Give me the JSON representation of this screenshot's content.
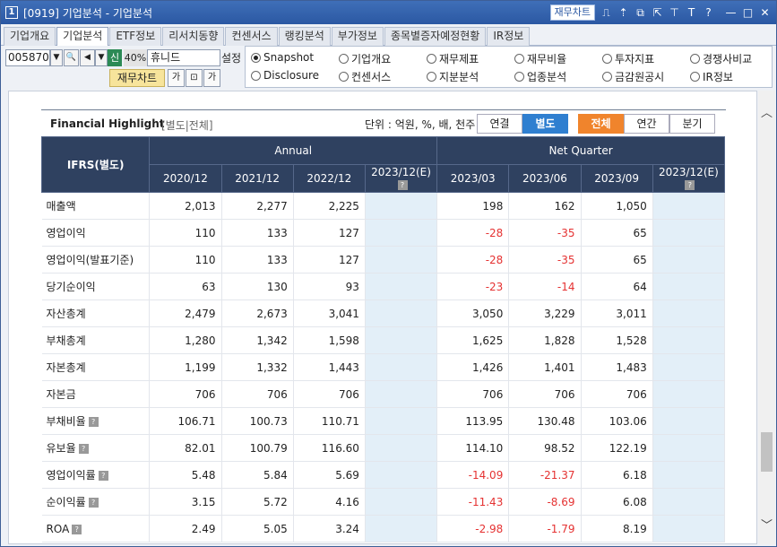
{
  "window": {
    "number": "1",
    "title": "[0919] 기업분석 - 기업분석",
    "chart_btn": "재무차트",
    "icons": [
      "chart-icon",
      "pin-up-icon",
      "copy-icon",
      "link-icon",
      "pin-icon",
      "text-icon",
      "help-icon",
      "minimize-icon",
      "maximize-icon",
      "close-icon"
    ],
    "icon_glyphs": [
      "⎍",
      "⇡",
      "⧉",
      "⇱",
      "⊤",
      "T",
      "?",
      "—",
      "□",
      "✕"
    ]
  },
  "tabs": [
    "기업개요",
    "기업분석",
    "ETF정보",
    "리서치동향",
    "컨센서스",
    "랭킹분석",
    "부가정보",
    "종목별증자예정현황",
    "IR정보"
  ],
  "controls": {
    "code": "005870",
    "badge": "신",
    "percent": "40%",
    "name": "휴니드",
    "setting": "설정",
    "fin_chart": "재무차트"
  },
  "radios": [
    {
      "label": "Snapshot",
      "checked": true
    },
    {
      "label": "기업개요",
      "checked": false
    },
    {
      "label": "재무제표",
      "checked": false
    },
    {
      "label": "재무비율",
      "checked": false
    },
    {
      "label": "투자지표",
      "checked": false
    },
    {
      "label": "경쟁사비교",
      "checked": false
    },
    {
      "label": "Disclosure",
      "checked": false
    },
    {
      "label": "컨센서스",
      "checked": false
    },
    {
      "label": "지분분석",
      "checked": false
    },
    {
      "label": "업종분석",
      "checked": false
    },
    {
      "label": "금감원공시",
      "checked": false
    },
    {
      "label": "IR정보",
      "checked": false
    }
  ],
  "highlight": {
    "title": "Financial Highlight",
    "subtitle": "[별도|전체]",
    "unit": "단위 : 억원, %, 배, 천주",
    "toggle1": [
      "연결",
      "별도"
    ],
    "toggle2": [
      "전체",
      "연간",
      "분기"
    ],
    "header_label": "IFRS(별도)",
    "group1": "Annual",
    "group2": "Net Quarter",
    "columns": [
      "2020/12",
      "2021/12",
      "2022/12",
      "2023/12(E)",
      "2023/03",
      "2023/06",
      "2023/09",
      "2023/12(E)"
    ],
    "rows": [
      {
        "label": "매출액",
        "help": false,
        "values": [
          "2,013",
          "2,277",
          "2,225",
          "",
          "198",
          "162",
          "1,050",
          ""
        ]
      },
      {
        "label": "영업이익",
        "help": false,
        "values": [
          "110",
          "133",
          "127",
          "",
          "-28",
          "-35",
          "65",
          ""
        ]
      },
      {
        "label": "영업이익(발표기준)",
        "help": false,
        "values": [
          "110",
          "133",
          "127",
          "",
          "-28",
          "-35",
          "65",
          ""
        ]
      },
      {
        "label": "당기순이익",
        "help": false,
        "values": [
          "63",
          "130",
          "93",
          "",
          "-23",
          "-14",
          "64",
          ""
        ]
      },
      {
        "label": "자산총계",
        "help": false,
        "values": [
          "2,479",
          "2,673",
          "3,041",
          "",
          "3,050",
          "3,229",
          "3,011",
          ""
        ]
      },
      {
        "label": "부채총계",
        "help": false,
        "values": [
          "1,280",
          "1,342",
          "1,598",
          "",
          "1,625",
          "1,828",
          "1,528",
          ""
        ]
      },
      {
        "label": "자본총계",
        "help": false,
        "values": [
          "1,199",
          "1,332",
          "1,443",
          "",
          "1,426",
          "1,401",
          "1,483",
          ""
        ]
      },
      {
        "label": "자본금",
        "help": false,
        "values": [
          "706",
          "706",
          "706",
          "",
          "706",
          "706",
          "706",
          ""
        ]
      },
      {
        "label": "부채비율",
        "help": true,
        "values": [
          "106.71",
          "100.73",
          "110.71",
          "",
          "113.95",
          "130.48",
          "103.06",
          ""
        ]
      },
      {
        "label": "유보율",
        "help": true,
        "values": [
          "82.01",
          "100.79",
          "116.60",
          "",
          "114.10",
          "98.52",
          "122.19",
          ""
        ]
      },
      {
        "label": "영업이익률",
        "help": true,
        "values": [
          "5.48",
          "5.84",
          "5.69",
          "",
          "-14.09",
          "-21.37",
          "6.18",
          ""
        ]
      },
      {
        "label": "순이익률",
        "help": true,
        "values": [
          "3.15",
          "5.72",
          "4.16",
          "",
          "-11.43",
          "-8.69",
          "6.08",
          ""
        ]
      },
      {
        "label": "ROA",
        "help": true,
        "values": [
          "2.49",
          "5.05",
          "3.24",
          "",
          "-2.98",
          "-1.79",
          "8.19",
          ""
        ]
      }
    ]
  }
}
